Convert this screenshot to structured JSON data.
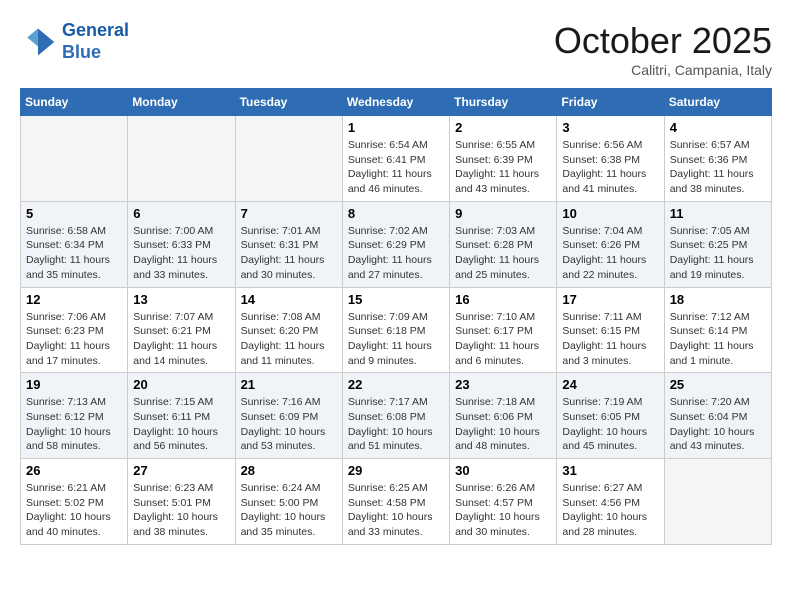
{
  "header": {
    "logo_line1": "General",
    "logo_line2": "Blue",
    "month": "October 2025",
    "location": "Calitri, Campania, Italy"
  },
  "weekdays": [
    "Sunday",
    "Monday",
    "Tuesday",
    "Wednesday",
    "Thursday",
    "Friday",
    "Saturday"
  ],
  "weeks": [
    [
      {
        "day": "",
        "info": ""
      },
      {
        "day": "",
        "info": ""
      },
      {
        "day": "",
        "info": ""
      },
      {
        "day": "1",
        "info": "Sunrise: 6:54 AM\nSunset: 6:41 PM\nDaylight: 11 hours\nand 46 minutes."
      },
      {
        "day": "2",
        "info": "Sunrise: 6:55 AM\nSunset: 6:39 PM\nDaylight: 11 hours\nand 43 minutes."
      },
      {
        "day": "3",
        "info": "Sunrise: 6:56 AM\nSunset: 6:38 PM\nDaylight: 11 hours\nand 41 minutes."
      },
      {
        "day": "4",
        "info": "Sunrise: 6:57 AM\nSunset: 6:36 PM\nDaylight: 11 hours\nand 38 minutes."
      }
    ],
    [
      {
        "day": "5",
        "info": "Sunrise: 6:58 AM\nSunset: 6:34 PM\nDaylight: 11 hours\nand 35 minutes."
      },
      {
        "day": "6",
        "info": "Sunrise: 7:00 AM\nSunset: 6:33 PM\nDaylight: 11 hours\nand 33 minutes."
      },
      {
        "day": "7",
        "info": "Sunrise: 7:01 AM\nSunset: 6:31 PM\nDaylight: 11 hours\nand 30 minutes."
      },
      {
        "day": "8",
        "info": "Sunrise: 7:02 AM\nSunset: 6:29 PM\nDaylight: 11 hours\nand 27 minutes."
      },
      {
        "day": "9",
        "info": "Sunrise: 7:03 AM\nSunset: 6:28 PM\nDaylight: 11 hours\nand 25 minutes."
      },
      {
        "day": "10",
        "info": "Sunrise: 7:04 AM\nSunset: 6:26 PM\nDaylight: 11 hours\nand 22 minutes."
      },
      {
        "day": "11",
        "info": "Sunrise: 7:05 AM\nSunset: 6:25 PM\nDaylight: 11 hours\nand 19 minutes."
      }
    ],
    [
      {
        "day": "12",
        "info": "Sunrise: 7:06 AM\nSunset: 6:23 PM\nDaylight: 11 hours\nand 17 minutes."
      },
      {
        "day": "13",
        "info": "Sunrise: 7:07 AM\nSunset: 6:21 PM\nDaylight: 11 hours\nand 14 minutes."
      },
      {
        "day": "14",
        "info": "Sunrise: 7:08 AM\nSunset: 6:20 PM\nDaylight: 11 hours\nand 11 minutes."
      },
      {
        "day": "15",
        "info": "Sunrise: 7:09 AM\nSunset: 6:18 PM\nDaylight: 11 hours\nand 9 minutes."
      },
      {
        "day": "16",
        "info": "Sunrise: 7:10 AM\nSunset: 6:17 PM\nDaylight: 11 hours\nand 6 minutes."
      },
      {
        "day": "17",
        "info": "Sunrise: 7:11 AM\nSunset: 6:15 PM\nDaylight: 11 hours\nand 3 minutes."
      },
      {
        "day": "18",
        "info": "Sunrise: 7:12 AM\nSunset: 6:14 PM\nDaylight: 11 hours\nand 1 minute."
      }
    ],
    [
      {
        "day": "19",
        "info": "Sunrise: 7:13 AM\nSunset: 6:12 PM\nDaylight: 10 hours\nand 58 minutes."
      },
      {
        "day": "20",
        "info": "Sunrise: 7:15 AM\nSunset: 6:11 PM\nDaylight: 10 hours\nand 56 minutes."
      },
      {
        "day": "21",
        "info": "Sunrise: 7:16 AM\nSunset: 6:09 PM\nDaylight: 10 hours\nand 53 minutes."
      },
      {
        "day": "22",
        "info": "Sunrise: 7:17 AM\nSunset: 6:08 PM\nDaylight: 10 hours\nand 51 minutes."
      },
      {
        "day": "23",
        "info": "Sunrise: 7:18 AM\nSunset: 6:06 PM\nDaylight: 10 hours\nand 48 minutes."
      },
      {
        "day": "24",
        "info": "Sunrise: 7:19 AM\nSunset: 6:05 PM\nDaylight: 10 hours\nand 45 minutes."
      },
      {
        "day": "25",
        "info": "Sunrise: 7:20 AM\nSunset: 6:04 PM\nDaylight: 10 hours\nand 43 minutes."
      }
    ],
    [
      {
        "day": "26",
        "info": "Sunrise: 6:21 AM\nSunset: 5:02 PM\nDaylight: 10 hours\nand 40 minutes."
      },
      {
        "day": "27",
        "info": "Sunrise: 6:23 AM\nSunset: 5:01 PM\nDaylight: 10 hours\nand 38 minutes."
      },
      {
        "day": "28",
        "info": "Sunrise: 6:24 AM\nSunset: 5:00 PM\nDaylight: 10 hours\nand 35 minutes."
      },
      {
        "day": "29",
        "info": "Sunrise: 6:25 AM\nSunset: 4:58 PM\nDaylight: 10 hours\nand 33 minutes."
      },
      {
        "day": "30",
        "info": "Sunrise: 6:26 AM\nSunset: 4:57 PM\nDaylight: 10 hours\nand 30 minutes."
      },
      {
        "day": "31",
        "info": "Sunrise: 6:27 AM\nSunset: 4:56 PM\nDaylight: 10 hours\nand 28 minutes."
      },
      {
        "day": "",
        "info": ""
      }
    ]
  ]
}
